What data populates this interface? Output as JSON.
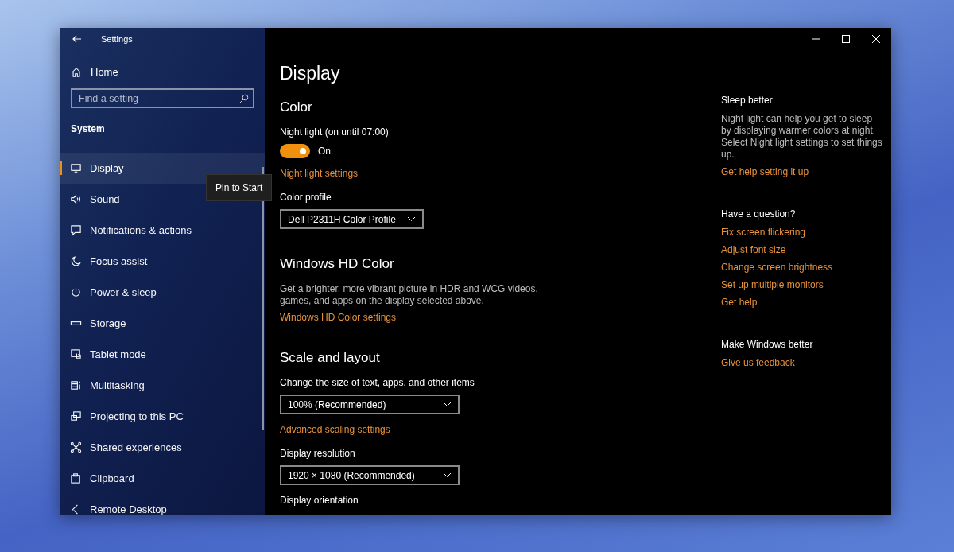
{
  "window": {
    "title": "Settings"
  },
  "nav": {
    "home": "Home",
    "search": {
      "placeholder": "Find a setting"
    },
    "section": "System",
    "tooltip": "Pin to Start",
    "items": [
      {
        "label": "Display",
        "selected": true
      },
      {
        "label": "Sound",
        "selected": false
      },
      {
        "label": "Notifications & actions",
        "selected": false
      },
      {
        "label": "Focus assist",
        "selected": false
      },
      {
        "label": "Power & sleep",
        "selected": false
      },
      {
        "label": "Storage",
        "selected": false
      },
      {
        "label": "Tablet mode",
        "selected": false
      },
      {
        "label": "Multitasking",
        "selected": false
      },
      {
        "label": "Projecting to this PC",
        "selected": false
      },
      {
        "label": "Shared experiences",
        "selected": false
      },
      {
        "label": "Clipboard",
        "selected": false
      },
      {
        "label": "Remote Desktop",
        "selected": false
      }
    ]
  },
  "page": {
    "title": "Display",
    "sections": [
      {
        "title": "Color",
        "items": [
          {
            "kind": "label",
            "text": "Night light (on until 07:00)"
          },
          {
            "kind": "toggle",
            "on": true,
            "text": "On"
          },
          {
            "kind": "link",
            "text": "Night light settings"
          },
          {
            "kind": "label",
            "text": "Color profile"
          },
          {
            "kind": "dropdown",
            "value": "Dell P2311H Color Profile"
          }
        ]
      },
      {
        "title": "Windows HD Color",
        "items": [
          {
            "kind": "paragraph",
            "text": "Get a brighter, more vibrant picture in HDR and WCG videos, games, and apps on the display selected above."
          },
          {
            "kind": "link",
            "text": "Windows HD Color settings"
          }
        ]
      },
      {
        "title": "Scale and layout",
        "items": [
          {
            "kind": "label",
            "text": "Change the size of text, apps, and other items"
          },
          {
            "kind": "dropdown",
            "value": "100% (Recommended)"
          },
          {
            "kind": "link",
            "text": "Advanced scaling settings"
          },
          {
            "kind": "label",
            "text": "Display resolution"
          },
          {
            "kind": "dropdown",
            "value": "1920 × 1080 (Recommended)"
          },
          {
            "kind": "label",
            "text": "Display orientation"
          }
        ]
      }
    ]
  },
  "help": [
    {
      "title": "Sleep better",
      "text": "Night light can help you get to sleep by displaying warmer colors at night. Select Night light settings to set things up.",
      "links": [
        "Get help setting it up"
      ]
    },
    {
      "title": "Have a question?",
      "links": [
        "Fix screen flickering",
        "Adjust font size",
        "Change screen brightness",
        "Set up multiple monitors",
        "Get help"
      ]
    },
    {
      "title": "Make Windows better",
      "links": [
        "Give us feedback"
      ]
    }
  ]
}
